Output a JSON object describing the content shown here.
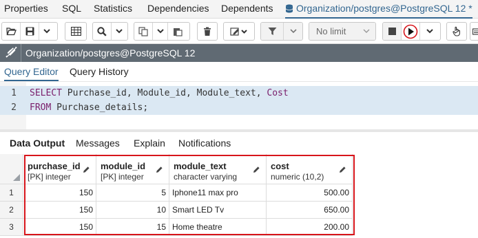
{
  "top_tabs": [
    {
      "label": "Properties"
    },
    {
      "label": "SQL"
    },
    {
      "label": "Statistics"
    },
    {
      "label": "Dependencies"
    },
    {
      "label": "Dependents"
    },
    {
      "label": "Organization/postgres@PostgreSQL 12 *",
      "icon": "database-icon",
      "active": true
    }
  ],
  "toolbar": {
    "limit_label": "No limit"
  },
  "connection": {
    "label": "Organization/postgres@PostgreSQL 12",
    "icon": "connection-status-icon"
  },
  "editor_tabs": [
    {
      "label": "Query Editor",
      "active": true
    },
    {
      "label": "Query History"
    }
  ],
  "editor": {
    "lines": [
      {
        "number": "1",
        "keyword": "SELECT",
        "rest": " Purchase_id, Module_id, Module_text, ",
        "keyword2": "Cost"
      },
      {
        "number": "2",
        "keyword": "FROM",
        "rest": " Purchase_details;",
        "keyword2": ""
      }
    ]
  },
  "output_tabs": [
    {
      "label": "Data Output",
      "active": true
    },
    {
      "label": "Messages"
    },
    {
      "label": "Explain"
    },
    {
      "label": "Notifications"
    }
  ],
  "result": {
    "columns": [
      {
        "name": "purchase_id",
        "type": "[PK] integer"
      },
      {
        "name": "module_id",
        "type": "[PK] integer"
      },
      {
        "name": "module_text",
        "type": "character varying"
      },
      {
        "name": "cost",
        "type": "numeric (10,2)"
      }
    ],
    "rows": [
      {
        "num": "1",
        "cells": [
          "150",
          "5",
          "Iphone11 max pro",
          "500.00"
        ]
      },
      {
        "num": "2",
        "cells": [
          "150",
          "10",
          "Smart LED Tv",
          "650.00"
        ]
      },
      {
        "num": "3",
        "cells": [
          "150",
          "15",
          "Home theatre",
          "200.00"
        ]
      }
    ]
  },
  "colors": {
    "accent": "#326690",
    "connection_bar": "#606a73",
    "highlight_box": "#d7141a",
    "sql_keyword": "#7a1e6b",
    "line_highlight": "#dbe8f3"
  }
}
